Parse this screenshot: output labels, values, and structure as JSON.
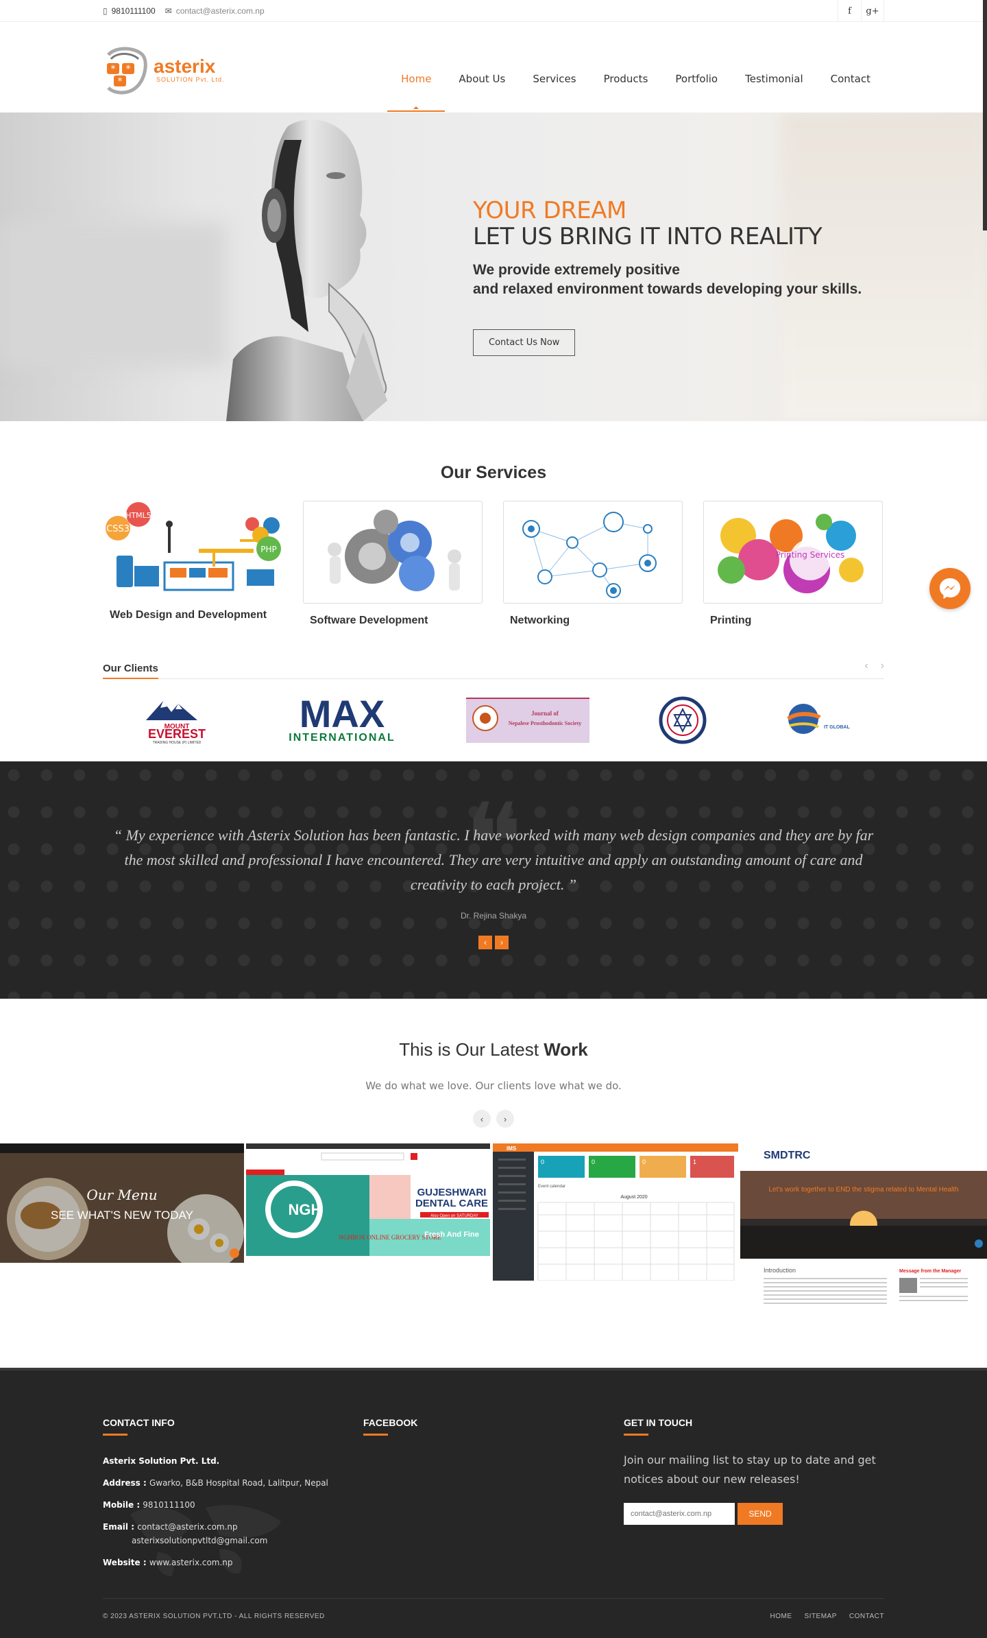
{
  "topbar": {
    "phone": "9810111100",
    "email": "contact@asterix.com.np",
    "social": [
      "f",
      "g+"
    ]
  },
  "logo": {
    "brand": "asterix",
    "sub": "SOLUTION Pvt. Ltd."
  },
  "nav": {
    "items": [
      "Home",
      "About Us",
      "Services",
      "Products",
      "Portfolio",
      "Testimonial",
      "Contact"
    ],
    "active": "Home"
  },
  "hero": {
    "line1": "YOUR DREAM",
    "line2": "LET US BRING IT INTO REALITY",
    "line3": "We provide extremely positive",
    "line4": "and relaxed environment towards developing your skills.",
    "button": "Contact Us Now"
  },
  "services": {
    "title": "Our Services",
    "items": [
      {
        "name": "Web Design and Development",
        "icon": "web-design-illustration"
      },
      {
        "name": "Software Development",
        "icon": "gears-illustration"
      },
      {
        "name": "Networking",
        "icon": "network-illustration"
      },
      {
        "name": "Printing",
        "icon": "printing-illustration",
        "label": "Printing Services"
      }
    ]
  },
  "clients": {
    "label": "Our Clients",
    "logos": [
      {
        "name": "mount-everest-logo",
        "line1": "MOUNT",
        "line2": "EVEREST",
        "line3": "TRADING HOUSE (P) LIMITED"
      },
      {
        "name": "max-international-logo",
        "line1": "MAX",
        "line2": "INTERNATIONAL"
      },
      {
        "name": "journal-logo",
        "line1": "Journal of",
        "line2": "Nepalese Prosthodontic Society"
      },
      {
        "name": "school-logo"
      },
      {
        "name": "it-global-logo",
        "line1": "IT GLOBAL"
      }
    ]
  },
  "testimonial": {
    "quote": "“ My experience with Asterix Solution has been fantastic. I have worked with many web design companies and they are by far the most skilled and professional I have encountered. They are very intuitive and apply an outstanding amount of care and creativity to each project. ”",
    "author": "Dr. Rejina Shakya"
  },
  "work": {
    "title_pre": "This is Our Latest ",
    "title_bold": "Work",
    "subtitle": "We do what we love. Our clients love what we do.",
    "shots": [
      {
        "name": "restaurant-site",
        "text1": "Our Menu",
        "text2": "SEE WHAT'S NEW TODAY"
      },
      {
        "name": "ngh-store-site",
        "text1": "GUJESHWARI",
        "text2": "DENTAL CARE",
        "text3": "NGHBOX ONLINE GROCERY STORE",
        "text4": "Fresh And Fine",
        "text5": "Also Open on SATURDAY"
      },
      {
        "name": "ims-dashboard",
        "text1": "IMS",
        "text2": "August 2020",
        "text3": "Event calendar"
      },
      {
        "name": "smdtrc-site",
        "text1": "SMDTRC",
        "text2": "Let's work together to END the stigma related to Mental Health",
        "text3": "Introduction",
        "text4": "Message from the Manager"
      }
    ]
  },
  "footer": {
    "contact_title": "CONTACT INFO",
    "company": "Asterix Solution Pvt. Ltd.",
    "address_label": "Address : ",
    "address": "Gwarko, B&B Hospital Road, Lalitpur, Nepal",
    "mobile_label": "Mobile : ",
    "mobile": "9810111100",
    "email_label": "Email : ",
    "email1": "contact@asterix.com.np",
    "email2": "asterixsolutionpvtltd@gmail.com",
    "website_label": "Website : ",
    "website": "www.asterix.com.np",
    "facebook_title": "FACEBOOK",
    "touch_title": "GET IN TOUCH",
    "touch_desc": "Join our mailing list to stay up to date and get notices about our new releases!",
    "input_placeholder": "contact@asterix.com.np",
    "send": "SEND",
    "copyright": "© 2023 ASTERIX SOLUTION PVT.LTD - ALL RIGHTS RESERVED",
    "links": [
      "HOME",
      "SITEMAP",
      "CONTACT"
    ]
  },
  "colors": {
    "accent": "#f07a24",
    "dark": "#262626"
  }
}
